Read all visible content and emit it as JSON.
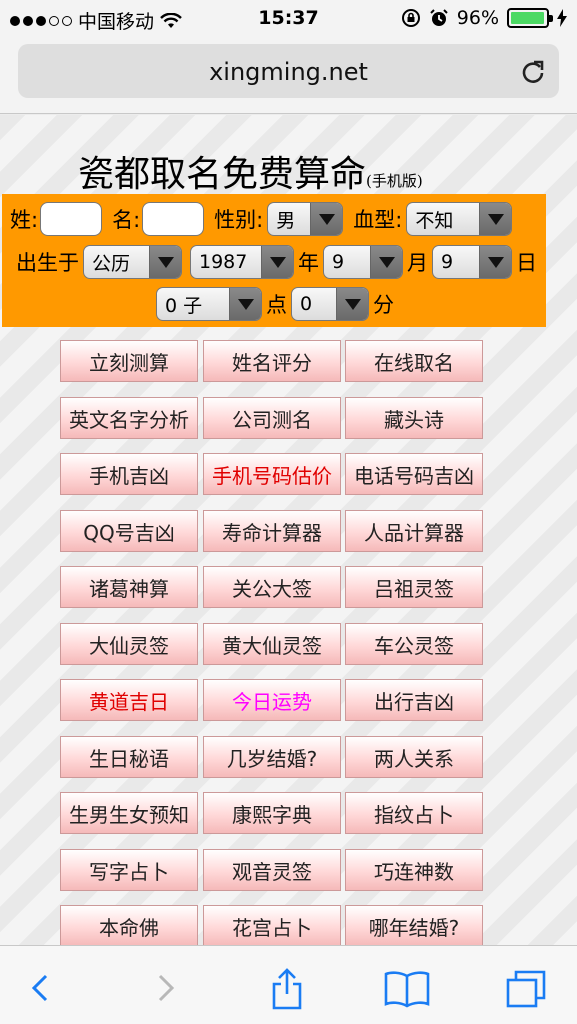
{
  "status": {
    "carrier": "中国移动",
    "time": "15:37",
    "battery_pct": "96%",
    "battery_level": 0.96,
    "signal_dots_filled": 3,
    "signal_dots_total": 5
  },
  "browser": {
    "url": "xingming.net"
  },
  "page": {
    "title": "瓷都取名免费算命",
    "title_suffix": "(手机版)"
  },
  "form": {
    "surname_label": "姓:",
    "name_label": "名:",
    "gender_label": "性别:",
    "gender_value": "男",
    "blood_label": "血型:",
    "blood_value": "不知",
    "born_label": "出生于",
    "calendar_value": "公历",
    "year_value": "1987",
    "year_label": "年",
    "month_value": "9",
    "month_label": "月",
    "day_value": "9",
    "day_label": "日",
    "hour_value": "0 子",
    "hour_label": "点",
    "minute_value": "0",
    "minute_label": "分"
  },
  "links": [
    {
      "label": "立刻测算",
      "color": "#222222"
    },
    {
      "label": "姓名评分",
      "color": "#222222"
    },
    {
      "label": "在线取名",
      "color": "#222222"
    },
    {
      "label": "英文名字分析",
      "color": "#222222"
    },
    {
      "label": "公司测名",
      "color": "#222222"
    },
    {
      "label": "藏头诗",
      "color": "#222222"
    },
    {
      "label": "手机吉凶",
      "color": "#222222"
    },
    {
      "label": "手机号码估价",
      "color": "#e00000"
    },
    {
      "label": "电话号码吉凶",
      "color": "#222222"
    },
    {
      "label": "QQ号吉凶",
      "color": "#222222"
    },
    {
      "label": "寿命计算器",
      "color": "#222222"
    },
    {
      "label": "人品计算器",
      "color": "#222222"
    },
    {
      "label": "诸葛神算",
      "color": "#222222"
    },
    {
      "label": "关公大签",
      "color": "#222222"
    },
    {
      "label": "吕祖灵签",
      "color": "#222222"
    },
    {
      "label": "大仙灵签",
      "color": "#222222"
    },
    {
      "label": "黄大仙灵签",
      "color": "#222222"
    },
    {
      "label": "车公灵签",
      "color": "#222222"
    },
    {
      "label": "黄道吉日",
      "color": "#e00000"
    },
    {
      "label": "今日运势",
      "color": "#ff00ff"
    },
    {
      "label": "出行吉凶",
      "color": "#222222"
    },
    {
      "label": "生日秘语",
      "color": "#222222"
    },
    {
      "label": "几岁结婚?",
      "color": "#222222"
    },
    {
      "label": "两人关系",
      "color": "#222222"
    },
    {
      "label": "生男生女预知",
      "color": "#222222"
    },
    {
      "label": "康熙字典",
      "color": "#222222"
    },
    {
      "label": "指纹占卜",
      "color": "#222222"
    },
    {
      "label": "写字占卜",
      "color": "#222222"
    },
    {
      "label": "观音灵签",
      "color": "#222222"
    },
    {
      "label": "巧连神数",
      "color": "#222222"
    },
    {
      "label": "本命佛",
      "color": "#222222"
    },
    {
      "label": "花宫占卜",
      "color": "#222222"
    },
    {
      "label": "哪年结婚?",
      "color": "#222222"
    }
  ],
  "colors": {
    "form_panel": "#ff9900",
    "tint": "#1a7cf3"
  }
}
